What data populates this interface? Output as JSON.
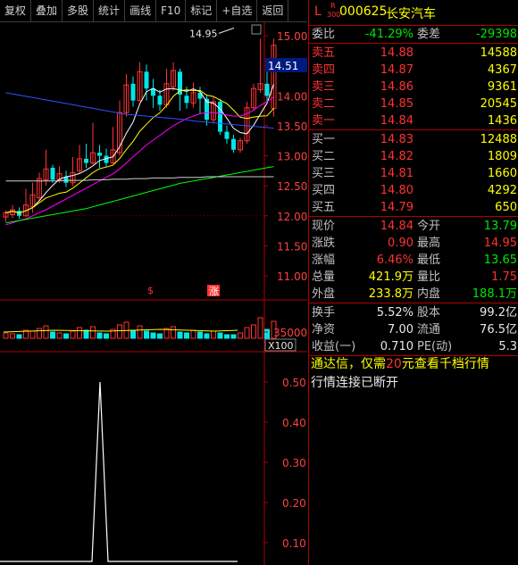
{
  "toolbar": {
    "items": [
      "复权",
      "叠加",
      "多股",
      "统计",
      "画线",
      "F10",
      "标记",
      "+自选",
      "返回"
    ]
  },
  "kline": {
    "y_ticks": [
      "15.00",
      "14.50",
      "14.00",
      "13.50",
      "13.00",
      "12.50",
      "12.00",
      "11.50",
      "11.00"
    ],
    "current_price_label": "14.51",
    "high_marker": "14.95",
    "markers": [
      "$",
      "涨"
    ]
  },
  "volume": {
    "tick_label": "35000",
    "unit": "X100"
  },
  "indicator": {
    "y_ticks": [
      "0.50",
      "0.40",
      "0.30",
      "0.20",
      "0.10"
    ]
  },
  "colors": {
    "up": "#ff3232",
    "down": "#00e6e6",
    "grid": "#b00000",
    "ma1": "#ffffff",
    "ma2": "#ffff00",
    "ma3": "#ff00ff",
    "ma4": "#00ff00",
    "ma5": "#3050ff"
  },
  "stock": {
    "prefix": "L",
    "badge_top": "R",
    "badge_bottom": "300",
    "code": "000625",
    "name": "长安汽车"
  },
  "quote": {
    "weibi_label": "委比",
    "weibi_value": "-41.29%",
    "weicha_label": "委差",
    "weicha_value": "-29398",
    "asks": [
      {
        "label": "卖五",
        "price": "14.88",
        "volume": "14588"
      },
      {
        "label": "卖四",
        "price": "14.87",
        "volume": "4367"
      },
      {
        "label": "卖三",
        "price": "14.86",
        "volume": "9361"
      },
      {
        "label": "卖二",
        "price": "14.85",
        "volume": "20545"
      },
      {
        "label": "卖一",
        "price": "14.84",
        "volume": "1436"
      }
    ],
    "bids": [
      {
        "label": "买一",
        "price": "14.83",
        "volume": "12488"
      },
      {
        "label": "买二",
        "price": "14.82",
        "volume": "1809"
      },
      {
        "label": "买三",
        "price": "14.81",
        "volume": "1660"
      },
      {
        "label": "买四",
        "price": "14.80",
        "volume": "4292"
      },
      {
        "label": "买五",
        "price": "14.79",
        "volume": "650"
      }
    ],
    "stats": [
      {
        "l1": "现价",
        "v1": "14.84",
        "l2": "今开",
        "v2": "13.79"
      },
      {
        "l1": "涨跌",
        "v1": "0.90",
        "l2": "最高",
        "v2": "14.95"
      },
      {
        "l1": "涨幅",
        "v1": "6.46%",
        "l2": "最低",
        "v2": "13.65"
      },
      {
        "l1": "总量",
        "v1": "421.9万",
        "l2": "量比",
        "v2": "1.75"
      },
      {
        "l1": "外盘",
        "v1": "233.8万",
        "l2": "内盘",
        "v2": "188.1万"
      }
    ],
    "finance": [
      {
        "l1": "换手",
        "v1": "5.52%",
        "l2": "股本",
        "v2": "99.2亿"
      },
      {
        "l1": "净资",
        "v1": "7.00",
        "l2": "流通",
        "v2": "76.5亿"
      },
      {
        "l1": "收益(一)",
        "v1": "0.710",
        "l2": "PE(动)",
        "v2": "5.3"
      }
    ]
  },
  "notice": {
    "line1_a": "通达信，仅需",
    "line1_b": "20",
    "line1_c": "元查看千档行情",
    "line2": "行情连接已断开"
  }
}
